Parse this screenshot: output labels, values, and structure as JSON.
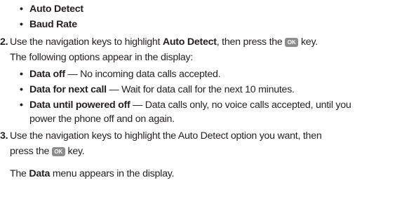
{
  "colors": {
    "text": "#231f20",
    "key_bg": "#8d8d8d",
    "key_text": "#ffffff"
  },
  "top_bullets": [
    "Auto Detect",
    "Baud Rate"
  ],
  "step2": {
    "number": "2.",
    "a": "Use the navigation keys to highlight ",
    "b": "Auto Detect",
    "c": ", then press the ",
    "key": "OK",
    "d": " key.",
    "line2": "The following options appear in the display:",
    "options": [
      {
        "term": "Data off",
        "desc": " — No incoming data calls accepted."
      },
      {
        "term": "Data for next call",
        "desc": " — Wait for data call for the next 10 minutes."
      },
      {
        "term": "Data until powered off",
        "desc": " — Data calls only, no voice calls accepted, until you",
        "cont": "power the phone off and on again."
      }
    ]
  },
  "step3": {
    "number": "3.",
    "line1": "Use the navigation keys to highlight the Auto Detect option you want, then",
    "line2a": "press the ",
    "key": "OK",
    "line2b": " key.",
    "result_a": "The ",
    "result_b": "Data",
    "result_c": " menu appears in the display."
  }
}
